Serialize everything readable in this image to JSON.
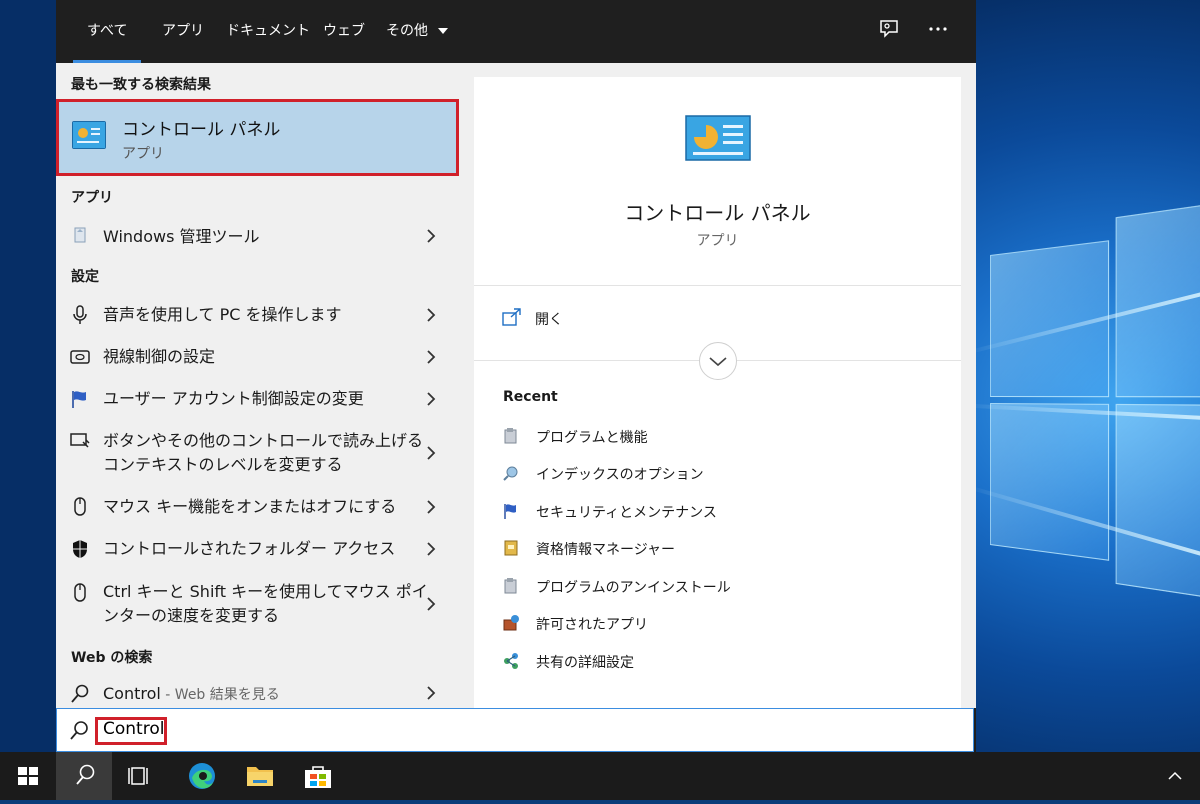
{
  "tabs": [
    {
      "label": "すべて",
      "active": true
    },
    {
      "label": "アプリ"
    },
    {
      "label": "ドキュメント"
    },
    {
      "label": "ウェブ"
    },
    {
      "label": "その他"
    }
  ],
  "sections": {
    "best_match": "最も一致する検索結果",
    "apps": "アプリ",
    "settings": "設定",
    "web": "Web の検索"
  },
  "best_match": {
    "title": "コントロール パネル",
    "subtitle": "アプリ"
  },
  "apps": [
    {
      "label": "Windows 管理ツール"
    }
  ],
  "settings": [
    {
      "label": "音声を使用して PC を操作します"
    },
    {
      "label": "視線制御の設定"
    },
    {
      "label": "ユーザー アカウント制御設定の変更"
    },
    {
      "label_line1": "ボタンやその他のコントロールで読み上げる",
      "label_line2": "コンテキストのレベルを変更する"
    },
    {
      "label": "マウス キー機能をオンまたはオフにする"
    },
    {
      "label": "コントロールされたフォルダー アクセス"
    },
    {
      "label_line1": "Ctrl キーと Shift キーを使用してマウス ポイ",
      "label_line2": "ンターの速度を変更する"
    }
  ],
  "web": {
    "query": "Control",
    "suffix": " - Web 結果を見る"
  },
  "search": {
    "value": "Control"
  },
  "preview": {
    "title": "コントロール パネル",
    "subtitle": "アプリ",
    "open_label": "開く",
    "recent_title": "Recent",
    "recent": [
      {
        "label": "プログラムと機能"
      },
      {
        "label": "インデックスのオプション"
      },
      {
        "label": "セキュリティとメンテナンス"
      },
      {
        "label": "資格情報マネージャー"
      },
      {
        "label": "プログラムのアンインストール"
      },
      {
        "label": "許可されたアプリ"
      },
      {
        "label": "共有の詳細設定"
      }
    ]
  },
  "colors": {
    "accent": "#3b8de0",
    "highlight": "#b7d4ea",
    "callout": "#d0202a"
  }
}
